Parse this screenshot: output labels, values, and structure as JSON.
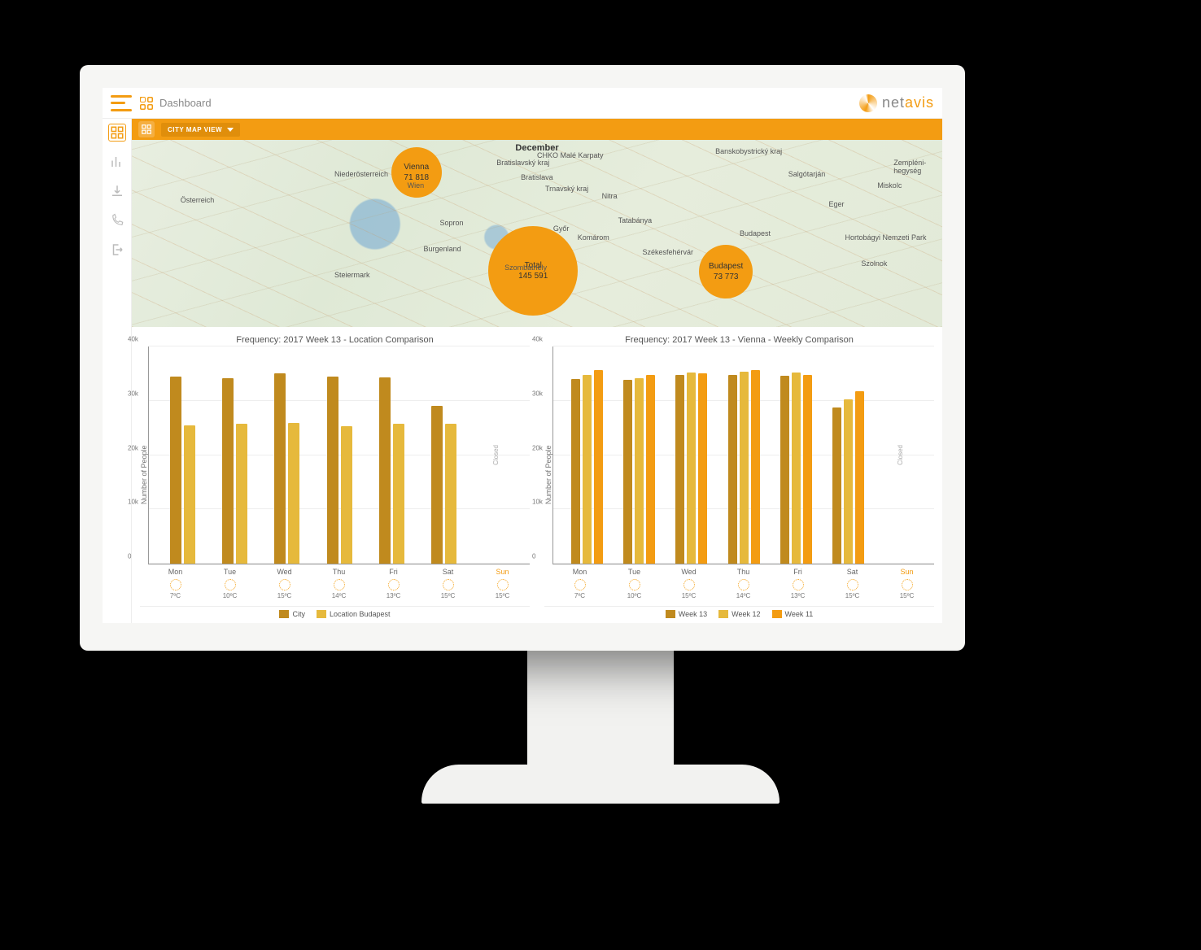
{
  "header": {
    "page_title": "Dashboard",
    "brand_name_prefix": "net",
    "brand_name_suffix": "avis"
  },
  "toolbar": {
    "view_selector_label": "CITY MAP VIEW"
  },
  "map": {
    "month_label": "December",
    "bubbles": {
      "vienna": {
        "name": "Vienna",
        "value": "71 818"
      },
      "total": {
        "name": "Total",
        "value": "145 591"
      },
      "budapest": {
        "name": "Budapest",
        "value": "73 773"
      }
    },
    "city_labels": [
      "Wien",
      "Bratislava",
      "Győr",
      "Tatabánya",
      "Budapest",
      "Székesfehérvár",
      "Szombathely",
      "Eger",
      "Miskolc",
      "Szolnok",
      "Sopron",
      "Steiermark",
      "Niederösterreich",
      "Burgenland",
      "Salgótarján",
      "Banskobystrický kraj",
      "Bratislavský kraj",
      "Trnavský kraj",
      "Nitra",
      "CHKO Malé Karpaty",
      "Hortobágyi Nemzeti Park",
      "Zempléni-hegység",
      "Komárom",
      "Österreich"
    ]
  },
  "chart_data": [
    {
      "type": "bar",
      "title": "Frequency: 2017 Week 13 - Location Comparison",
      "ylabel": "Number of People",
      "ylim": [
        0,
        40000
      ],
      "yticks": [
        "0",
        "10k",
        "20k",
        "30k",
        "40k"
      ],
      "categories": [
        "Mon",
        "Tue",
        "Wed",
        "Thu",
        "Fri",
        "Sat",
        "Sun"
      ],
      "closed_days": [
        "Sun"
      ],
      "closed_label": "Closed",
      "series": [
        {
          "name": "City",
          "color": "#c08a1e",
          "values": [
            34500,
            34200,
            35000,
            34400,
            34300,
            29000,
            null
          ]
        },
        {
          "name": "Location Budapest",
          "color": "#e6b93c",
          "values": [
            25500,
            25800,
            25900,
            25300,
            25800,
            25800,
            null
          ]
        }
      ],
      "weather": [
        {
          "day": "Mon",
          "temp": "7ºC"
        },
        {
          "day": "Tue",
          "temp": "10ºC"
        },
        {
          "day": "Wed",
          "temp": "15ºC"
        },
        {
          "day": "Thu",
          "temp": "14ºC"
        },
        {
          "day": "Fri",
          "temp": "13ºC"
        },
        {
          "day": "Sat",
          "temp": "15ºC"
        },
        {
          "day": "Sun",
          "temp": "15ºC"
        }
      ]
    },
    {
      "type": "bar",
      "title": "Frequency: 2017 Week 13 - Vienna - Weekly Comparison",
      "ylabel": "Number of People",
      "ylim": [
        0,
        40000
      ],
      "yticks": [
        "0",
        "10k",
        "20k",
        "30k",
        "40k"
      ],
      "categories": [
        "Mon",
        "Tue",
        "Wed",
        "Thu",
        "Fri",
        "Sat",
        "Sun"
      ],
      "closed_days": [
        "Sun"
      ],
      "closed_label": "Closed",
      "series": [
        {
          "name": "Week 13",
          "color": "#c08a1e",
          "values": [
            34000,
            33800,
            34800,
            34800,
            34600,
            28800,
            null
          ]
        },
        {
          "name": "Week 12",
          "color": "#e6b93c",
          "values": [
            34800,
            34200,
            35200,
            35400,
            35200,
            30200,
            null
          ]
        },
        {
          "name": "Week 11",
          "color": "#f39c12",
          "values": [
            35600,
            34800,
            35000,
            35600,
            34800,
            31800,
            null
          ]
        }
      ],
      "weather": [
        {
          "day": "Mon",
          "temp": "7ºC"
        },
        {
          "day": "Tue",
          "temp": "10ºC"
        },
        {
          "day": "Wed",
          "temp": "15ºC"
        },
        {
          "day": "Thu",
          "temp": "14ºC"
        },
        {
          "day": "Fri",
          "temp": "13ºC"
        },
        {
          "day": "Sat",
          "temp": "15ºC"
        },
        {
          "day": "Sun",
          "temp": "15ºC"
        }
      ]
    }
  ]
}
